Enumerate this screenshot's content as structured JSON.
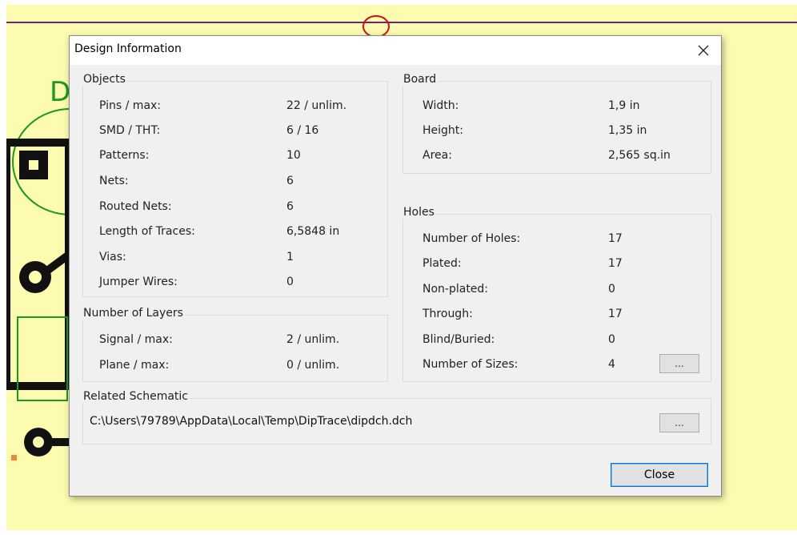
{
  "canvas": {
    "background_color": "#fdfbb0",
    "designator_fragment": "D",
    "trace_color": "#7a1f7a",
    "marker_color": "#d01010",
    "outline_color": "#1a9a1a"
  },
  "dialog": {
    "title": "Design Information",
    "close_icon": "close-icon",
    "objects": {
      "title": "Objects",
      "rows": [
        {
          "label": "Pins / max:",
          "value": "22 / unlim."
        },
        {
          "label": "SMD / THT:",
          "value": "6 / 16"
        },
        {
          "label": "Patterns:",
          "value": "10"
        },
        {
          "label": "Nets:",
          "value": "6"
        },
        {
          "label": "Routed Nets:",
          "value": "6"
        },
        {
          "label": "Length of Traces:",
          "value": "6,5848 in"
        },
        {
          "label": "Vias:",
          "value": "1"
        },
        {
          "label": "Jumper Wires:",
          "value": "0"
        }
      ]
    },
    "layers": {
      "title": "Number of Layers",
      "rows": [
        {
          "label": "Signal / max:",
          "value": "2 / unlim."
        },
        {
          "label": "Plane / max:",
          "value": "0 / unlim."
        }
      ]
    },
    "board": {
      "title": "Board",
      "rows": [
        {
          "label": "Width:",
          "value": "1,9 in"
        },
        {
          "label": "Height:",
          "value": "1,35 in"
        },
        {
          "label": "Area:",
          "value": "2,565 sq.in"
        }
      ]
    },
    "holes": {
      "title": "Holes",
      "rows": [
        {
          "label": "Number of Holes:",
          "value": "17"
        },
        {
          "label": "Plated:",
          "value": "17"
        },
        {
          "label": "Non-plated:",
          "value": "0"
        },
        {
          "label": "Through:",
          "value": "17"
        },
        {
          "label": "Blind/Buried:",
          "value": "0"
        },
        {
          "label": "Number of Sizes:",
          "value": "4"
        }
      ],
      "sizes_button_label": "..."
    },
    "schematic": {
      "title": "Related Schematic",
      "path": "C:\\Users\\79789\\AppData\\Local\\Temp\\DipTrace\\dipdch.dch",
      "browse_button_label": "..."
    },
    "close_button_label": "Close"
  }
}
